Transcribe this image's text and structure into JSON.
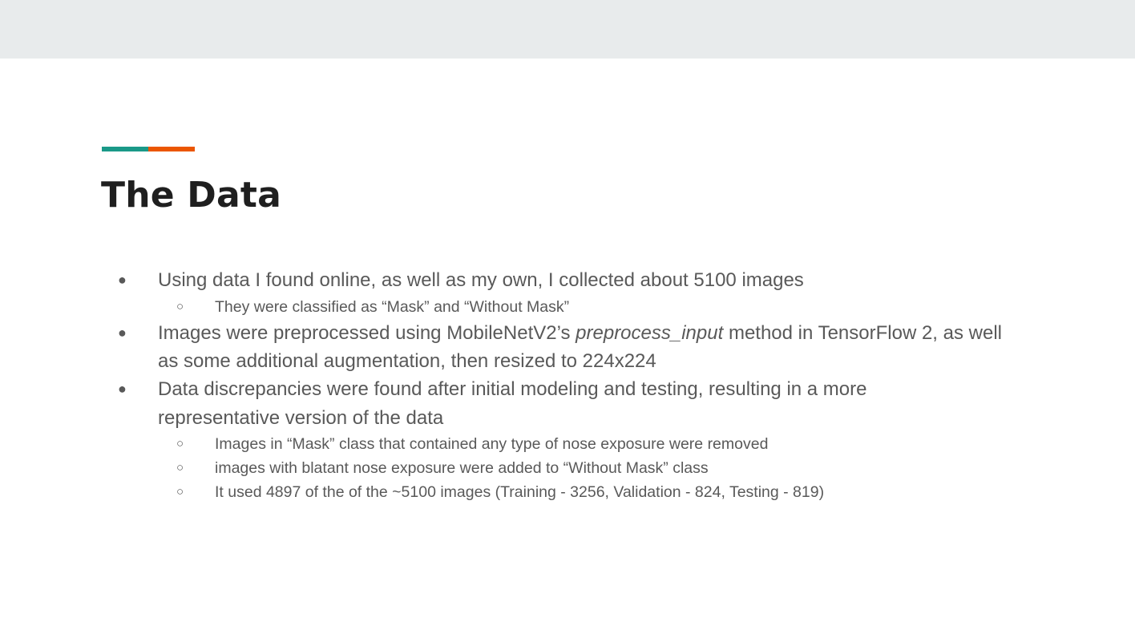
{
  "slide": {
    "title": "The Data",
    "accent_colors": [
      "#1a9988",
      "#eb5600"
    ]
  },
  "bullets": {
    "b1": "Using data I found online, as well as my own, I collected about 5100 images",
    "b1_sub1": "They were classified  as “Mask” and “Without Mask”",
    "b2_part1": "Images were preprocessed using MobileNetV2’s ",
    "b2_italic": "preprocess_input",
    "b2_part2": " method in TensorFlow 2, as well",
    "b2_line2": "as some additional augmentation, then resized to 224x224",
    "b3_line1": "Data discrepancies were found after initial modeling and testing, resulting in a more",
    "b3_line2": "representative version of the data",
    "b3_sub1": "Images in “Mask” class that contained any type of nose exposure were removed",
    "b3_sub2": "images with blatant nose exposure were added to “Without Mask” class",
    "b3_sub3": "It used 4897 of the of the ~5100  images (Training - 3256, Validation - 824, Testing - 819)"
  },
  "bullet_glyphs": {
    "level1": "●",
    "level2": "○"
  }
}
